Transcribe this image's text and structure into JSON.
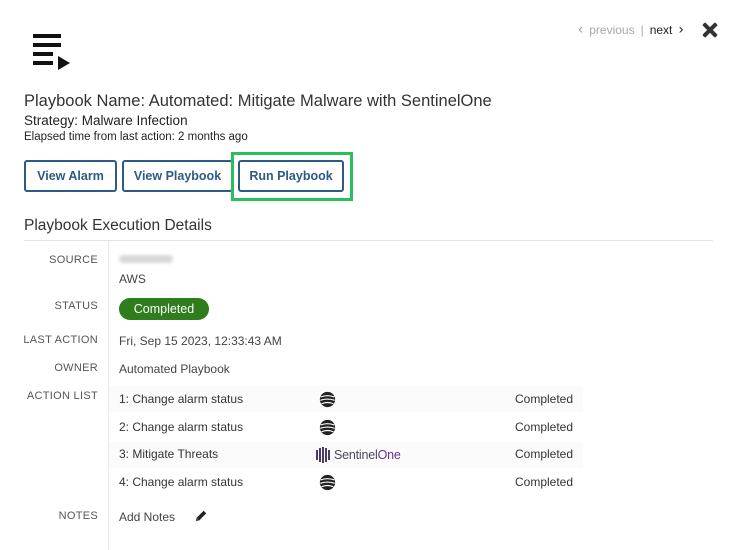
{
  "nav": {
    "previous_label": "previous",
    "separator": "|",
    "next_label": "next",
    "icons": {
      "prev": "chevron-left-icon",
      "next": "chevron-right-icon",
      "close": "close-icon"
    }
  },
  "header": {
    "icon": "playlist-play-icon",
    "title": "Playbook Name: Automated: Mitigate Malware with SentinelOne",
    "strategy": "Strategy: Malware Infection",
    "elapsed": "Elapsed time from last action: 2 months ago"
  },
  "buttons": {
    "view_alarm": "View Alarm",
    "view_playbook": "View Playbook",
    "run_playbook": "Run Playbook"
  },
  "details": {
    "section_title": "Playbook Execution Details",
    "labels": {
      "source": "SOURCE",
      "status": "STATUS",
      "last_action": "LAST ACTION",
      "owner": "OWNER",
      "action_list": "ACTION LIST",
      "notes": "NOTES"
    },
    "source_value": "AWS",
    "status_value": "Completed",
    "last_action_value": "Fri, Sep 15 2023, 12:33:43 AM",
    "owner_value": "Automated Playbook",
    "notes_placeholder": "Add Notes"
  },
  "action_list": [
    {
      "label": "1: Change alarm status",
      "integration": "att-globe-icon",
      "status": "Completed"
    },
    {
      "label": "2: Change alarm status",
      "integration": "att-globe-icon",
      "status": "Completed"
    },
    {
      "label": "3: Mitigate Threats",
      "integration": "sentinelone-logo",
      "integration_text_1": "Sentinel",
      "integration_text_2": "One",
      "status": "Completed"
    },
    {
      "label": "4: Change alarm status",
      "integration": "att-globe-icon",
      "status": "Completed"
    }
  ],
  "colors": {
    "button_border": "#2d5b86",
    "highlight": "#29c05c",
    "status_badge": "#2f7d1c",
    "sentinelone_accent": "#6b2f8f"
  }
}
